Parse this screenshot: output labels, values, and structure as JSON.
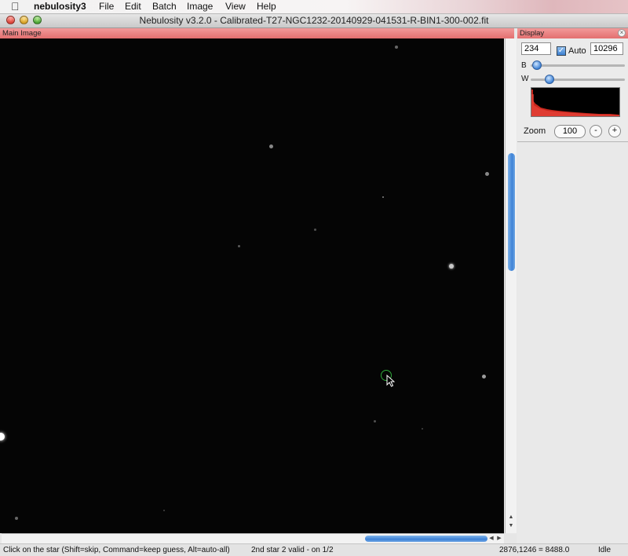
{
  "menubar": {
    "apple_icon": "apple-logo-icon",
    "app_name": "nebulosity3",
    "items": [
      "File",
      "Edit",
      "Batch",
      "Image",
      "View",
      "Help"
    ]
  },
  "window": {
    "title": "Nebulosity v3.2.0 - Calibrated-T27-NGC1232-20140929-041531-R-BIN1-300-002.fit"
  },
  "main_panel": {
    "header": "Main Image"
  },
  "display_panel": {
    "header": "Display",
    "black_value": "234",
    "auto_label": "Auto",
    "auto_checked": true,
    "white_value": "10296",
    "b_label": "B",
    "w_label": "W",
    "zoom_label": "Zoom",
    "zoom_value": "100",
    "zoom_out": "-",
    "zoom_in": "+"
  },
  "status": {
    "hint": "Click on the star (Shift=skip, Command=keep guess, Alt=auto-all)",
    "message": "2nd star 2 valid - on 1/2",
    "coords": "2876,1246 = 8488.0",
    "state": "Idle"
  },
  "colors": {
    "panel_header": "#e8807f",
    "image_bg": "#050505",
    "histogram": "#c8281e",
    "selection_circle": "#2fa83a",
    "scroll_thumb": "#3e82d6"
  }
}
